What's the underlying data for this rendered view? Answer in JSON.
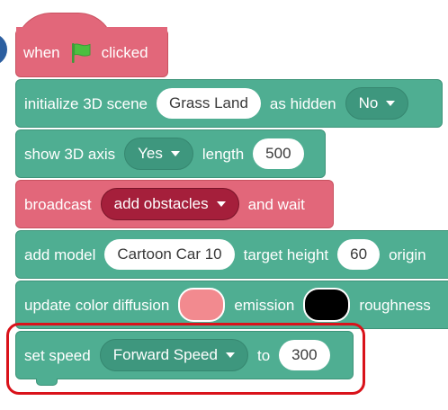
{
  "hat_block": {
    "when_label": "when",
    "clicked_label": "clicked",
    "flag_icon": "green-flag-icon",
    "color": "#e2677a"
  },
  "init_scene_block": {
    "label": "initialize 3D scene",
    "scene_value": "Grass Land",
    "hidden_label": "as hidden",
    "hidden_value": "No"
  },
  "axis_block": {
    "label": "show 3D axis",
    "axis_value": "Yes",
    "length_label": "length",
    "length_value": "500"
  },
  "broadcast_block": {
    "label": "broadcast",
    "message_value": "add obstacles",
    "suffix_label": "and wait"
  },
  "add_model_block": {
    "label": "add model",
    "model_value": "Cartoon Car 10",
    "height_label": "target height",
    "height_value": "60",
    "trailing_label": "origin"
  },
  "color_block": {
    "label": "update color diffusion",
    "diffusion_color": "#f28a8f",
    "emission_label": "emission",
    "emission_color": "#000000",
    "roughness_label": "roughness"
  },
  "speed_block": {
    "label": "set speed",
    "speed_type_value": "Forward Speed",
    "to_label": "to",
    "speed_value": "300"
  },
  "colors": {
    "teal": "#4fae92",
    "teal_dark": "#3e977e",
    "pink": "#e2677a",
    "broadcast_drop": "#a51f3b",
    "highlight": "#d9121a",
    "side_tab": "#2c5fa0"
  }
}
